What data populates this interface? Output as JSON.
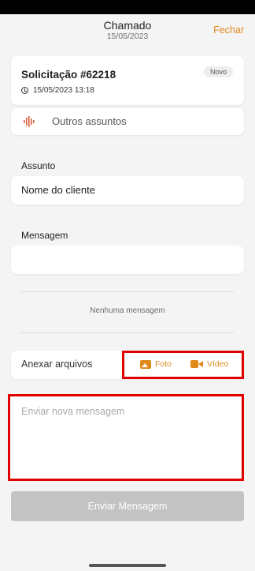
{
  "header": {
    "title": "Chamado",
    "date": "15/05/2023",
    "close_label": "Fechar"
  },
  "ticket": {
    "title": "Solicitação #62218",
    "status_badge": "Novo",
    "datetime": "15/05/2023 13:18",
    "category": "Outros assuntos",
    "category_icon": "waveform-icon"
  },
  "subject": {
    "label": "Assunto",
    "value": "Nome do cliente"
  },
  "message": {
    "label": "Mensagem",
    "value": ""
  },
  "history": {
    "empty_text": "Nenhuma mensagem"
  },
  "attachments": {
    "label": "Anexar arquivos",
    "photo_label": "Foto",
    "video_label": "Vídeo"
  },
  "compose": {
    "placeholder": "Enviar nova mensagem",
    "send_label": "Enviar Mensagem"
  },
  "colors": {
    "accent": "#e08a1e",
    "highlight": "#e00000",
    "disabled_button": "#c3c3c3"
  }
}
